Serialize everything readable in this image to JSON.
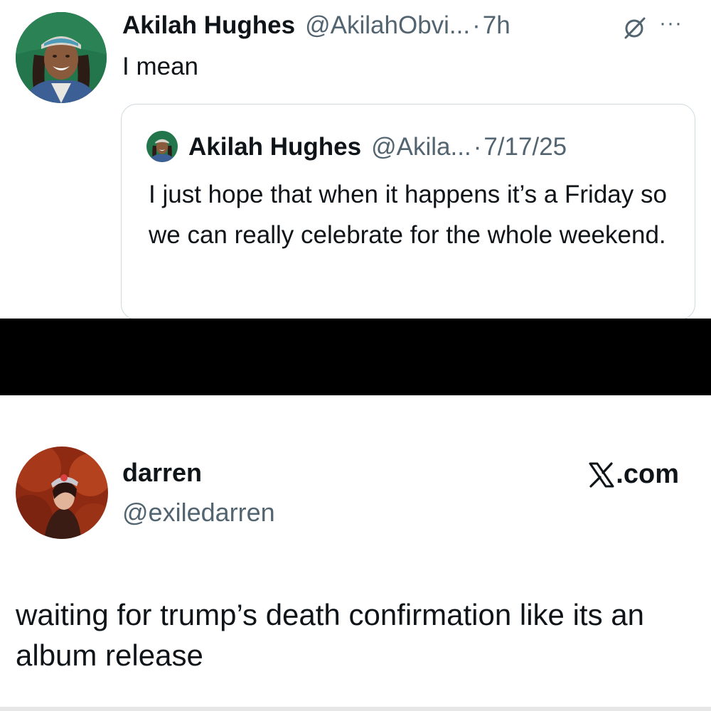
{
  "top_tweet": {
    "author_name": "Akilah Hughes",
    "author_handle": "@AkilahObvi...",
    "separator": "·",
    "time": "7h",
    "text": "I mean",
    "quote": {
      "author_name": "Akilah Hughes",
      "author_handle": "@Akila...",
      "separator": "·",
      "date": "7/17/25",
      "text": "I just hope that when it happens it’s a Friday so we can really celebrate for the whole weekend."
    }
  },
  "bottom_tweet": {
    "author_name": "darren",
    "author_handle": "@exiledarren",
    "site_label": ".com",
    "text": "waiting for trump’s death confirmation like its an album release"
  },
  "icons": {
    "grok": "grok-icon",
    "more": "more-icon",
    "x_logo": "x-logo-icon"
  },
  "colors": {
    "text_primary": "#0f1419",
    "text_secondary": "#536471",
    "border": "#cfd9de",
    "divider": "#000000"
  }
}
